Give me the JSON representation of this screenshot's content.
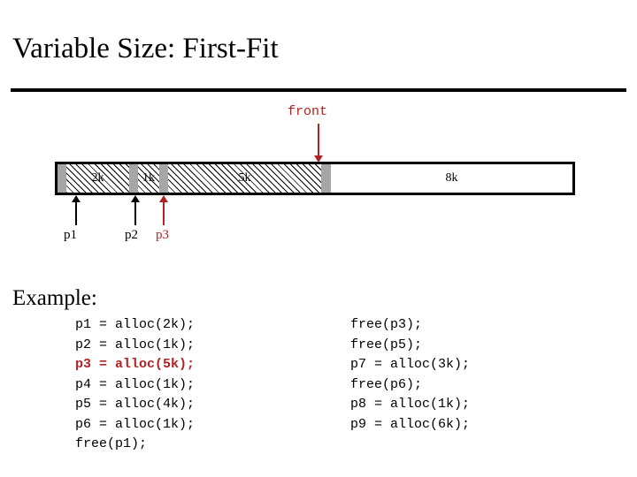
{
  "slide": {
    "title": "Variable Size: First-Fit",
    "example_heading": "Example:"
  },
  "diagram": {
    "front_pointer_label": "front",
    "blocks": [
      {
        "name": "header-p1",
        "kind": "header",
        "label": ""
      },
      {
        "name": "block-2k",
        "kind": "allocated",
        "label": "2k"
      },
      {
        "name": "header-p2",
        "kind": "header",
        "label": ""
      },
      {
        "name": "block-1k",
        "kind": "allocated",
        "label": "1k"
      },
      {
        "name": "header-p3",
        "kind": "header",
        "label": ""
      },
      {
        "name": "block-5k",
        "kind": "allocated",
        "label": "5k"
      },
      {
        "name": "header-free",
        "kind": "header",
        "label": ""
      },
      {
        "name": "block-8k",
        "kind": "free",
        "label": "8k"
      }
    ],
    "pointers": [
      {
        "label": "p1",
        "color": "black"
      },
      {
        "label": "p2",
        "color": "black"
      },
      {
        "label": "p3",
        "color": "red"
      }
    ]
  },
  "code": {
    "left_column": [
      {
        "text": "p1 = alloc(2k);",
        "highlight": false
      },
      {
        "text": "p2 = alloc(1k);",
        "highlight": false
      },
      {
        "text": "p3 = alloc(5k);",
        "highlight": true
      },
      {
        "text": "p4 = alloc(1k);",
        "highlight": false
      },
      {
        "text": "p5 = alloc(4k);",
        "highlight": false
      },
      {
        "text": "p6 = alloc(1k);",
        "highlight": false
      },
      {
        "text": "free(p1);",
        "highlight": false
      }
    ],
    "right_column": [
      {
        "text": "free(p3);",
        "highlight": false
      },
      {
        "text": "free(p5);",
        "highlight": false
      },
      {
        "text": "p7 = alloc(3k);",
        "highlight": false
      },
      {
        "text": "free(p6);",
        "highlight": false
      },
      {
        "text": "p8 = alloc(1k);",
        "highlight": false
      },
      {
        "text": "p9 = alloc(6k);",
        "highlight": false
      }
    ]
  },
  "colors": {
    "accent_red": "#B22222",
    "header_gray": "#A6A6A6",
    "ink": "#000000"
  }
}
